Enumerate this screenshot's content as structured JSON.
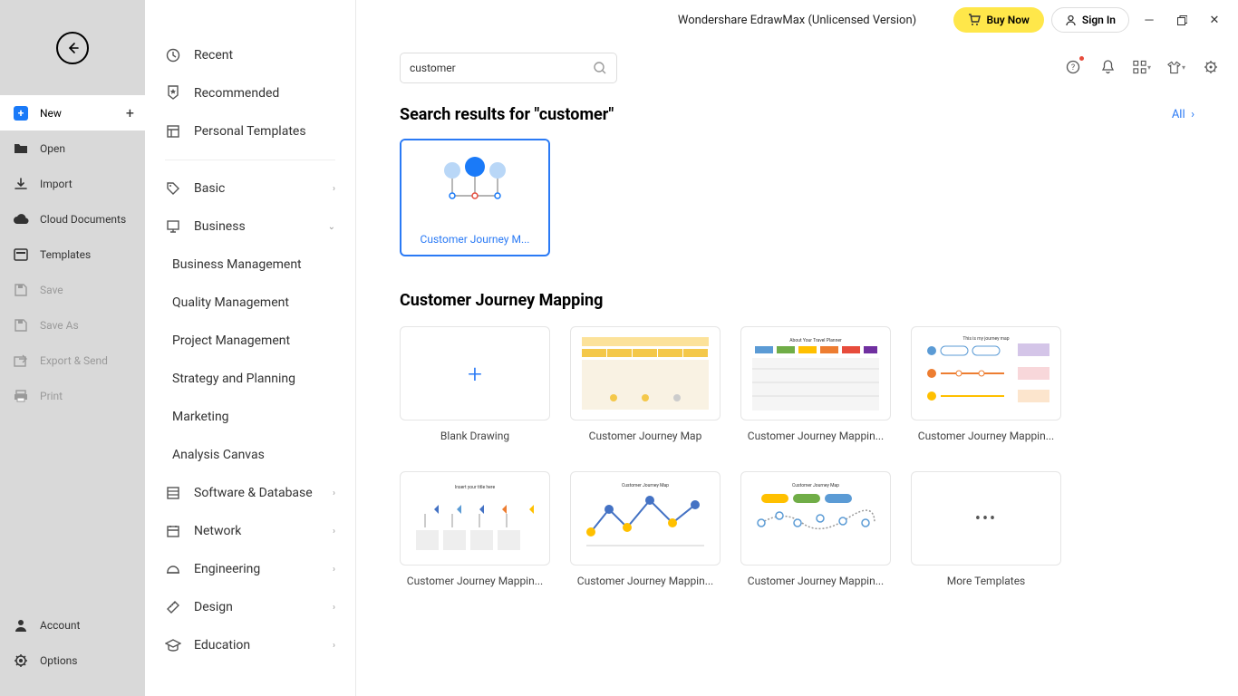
{
  "appTitle": "Wondershare EdrawMax (Unlicensed Version)",
  "buyNow": "Buy Now",
  "signIn": "Sign In",
  "leftMenu": {
    "new": "New",
    "open": "Open",
    "import": "Import",
    "cloud": "Cloud Documents",
    "templates": "Templates",
    "save": "Save",
    "saveAs": "Save As",
    "export": "Export & Send",
    "print": "Print",
    "account": "Account",
    "options": "Options"
  },
  "midMenu": {
    "recent": "Recent",
    "recommended": "Recommended",
    "personal": "Personal Templates",
    "basic": "Basic",
    "business": "Business",
    "subs": [
      "Business Management",
      "Quality Management",
      "Project Management",
      "Strategy and Planning",
      "Marketing",
      "Analysis Canvas"
    ],
    "software": "Software & Database",
    "network": "Network",
    "engineering": "Engineering",
    "design": "Design",
    "education": "Education"
  },
  "search": {
    "value": "customer"
  },
  "resultsTitle": "Search results for \"customer\"",
  "allLink": "All",
  "searchResult": "Customer Journey M...",
  "catTitle": "Customer Journey Mapping",
  "templates": [
    "Blank Drawing",
    "Customer Journey Map",
    "Customer Journey Mappin...",
    "Customer Journey Mappin...",
    "Customer Journey Mappin...",
    "Customer Journey Mappin...",
    "Customer Journey Mappin...",
    "More Templates"
  ]
}
